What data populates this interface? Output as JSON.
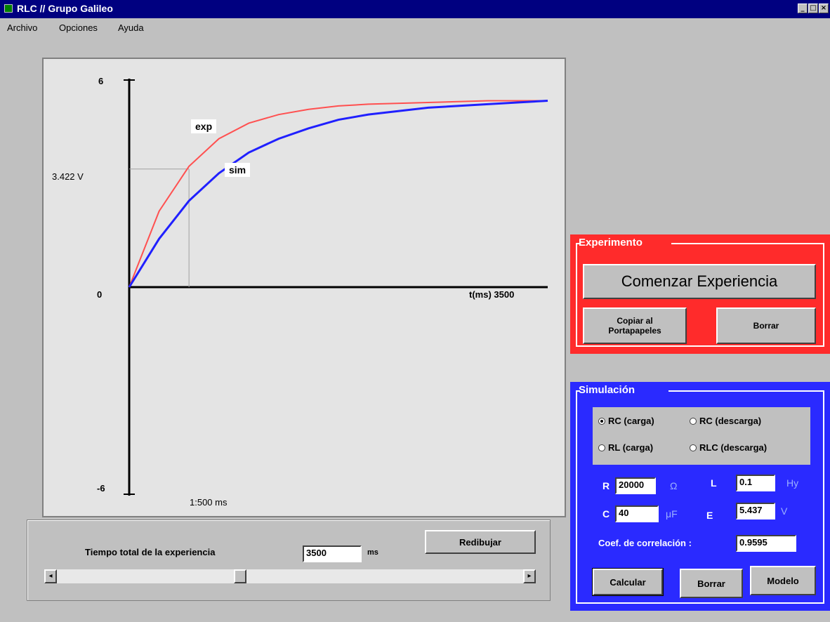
{
  "window": {
    "title": "RLC // Grupo Galileo"
  },
  "menu": [
    "Archivo",
    "Opciones",
    "Ayuda"
  ],
  "graph": {
    "y_max_label": "6",
    "y_zero_label": "0",
    "y_min_label": "-6",
    "cursor_value_label": "3.422 V",
    "x_axis_label": "t(ms) 3500",
    "scale_label": "1:500 ms",
    "series_exp_label": "exp",
    "series_sim_label": "sim",
    "exp_color": "#ff5050",
    "sim_color": "#2020ff"
  },
  "chart_data": {
    "type": "line",
    "ylim": [
      -6,
      6
    ],
    "xlim": [
      0,
      3500
    ],
    "xlabel": "t(ms) 3500",
    "cursor": {
      "x": 500,
      "y": 3.422
    },
    "series": [
      {
        "name": "exp",
        "x": [
          0,
          250,
          500,
          750,
          1000,
          1250,
          1500,
          1750,
          2000,
          2500,
          3000,
          3500
        ],
        "values": [
          0,
          2.2,
          3.5,
          4.3,
          4.75,
          5.0,
          5.15,
          5.25,
          5.3,
          5.35,
          5.4,
          5.4
        ]
      },
      {
        "name": "sim",
        "x": [
          0,
          250,
          500,
          750,
          1000,
          1250,
          1500,
          1750,
          2000,
          2500,
          3000,
          3500
        ],
        "values": [
          0,
          1.4,
          2.5,
          3.3,
          3.9,
          4.3,
          4.6,
          4.85,
          5.0,
          5.2,
          5.3,
          5.4
        ]
      }
    ]
  },
  "controls": {
    "total_time_label": "Tiempo total de la experiencia",
    "total_time_value": "3500",
    "total_time_unit": "ms",
    "redraw_button": "Redibujar"
  },
  "experimento": {
    "title": "Experimento",
    "start_button": "Comenzar Experiencia",
    "copy_button_line1": "Copiar al",
    "copy_button_line2": "Portapapeles",
    "clear_button": "Borrar",
    "panel_color": "#ff2b2b"
  },
  "simulacion": {
    "title": "Simulación",
    "panel_color": "#2a2aff",
    "radio_rc_carga": "RC (carga)",
    "radio_rc_descarga": "RC (descarga)",
    "radio_rl_carga": "RL (carga)",
    "radio_rlc_descarga": "RLC (descarga)",
    "selected": "RC (carga)",
    "r_label": "R",
    "r_value": "20000",
    "r_unit": "Ω",
    "l_label": "L",
    "l_value": "0.1",
    "l_unit": "Hy",
    "c_label": "C",
    "c_value": "40",
    "c_unit": "μF",
    "e_label": "E",
    "e_value": "5.437",
    "e_unit": "V",
    "corr_label": "Coef. de correlación :",
    "corr_value": "0.9595",
    "calc_button": "Calcular",
    "clear_button": "Borrar",
    "model_button": "Modelo"
  }
}
